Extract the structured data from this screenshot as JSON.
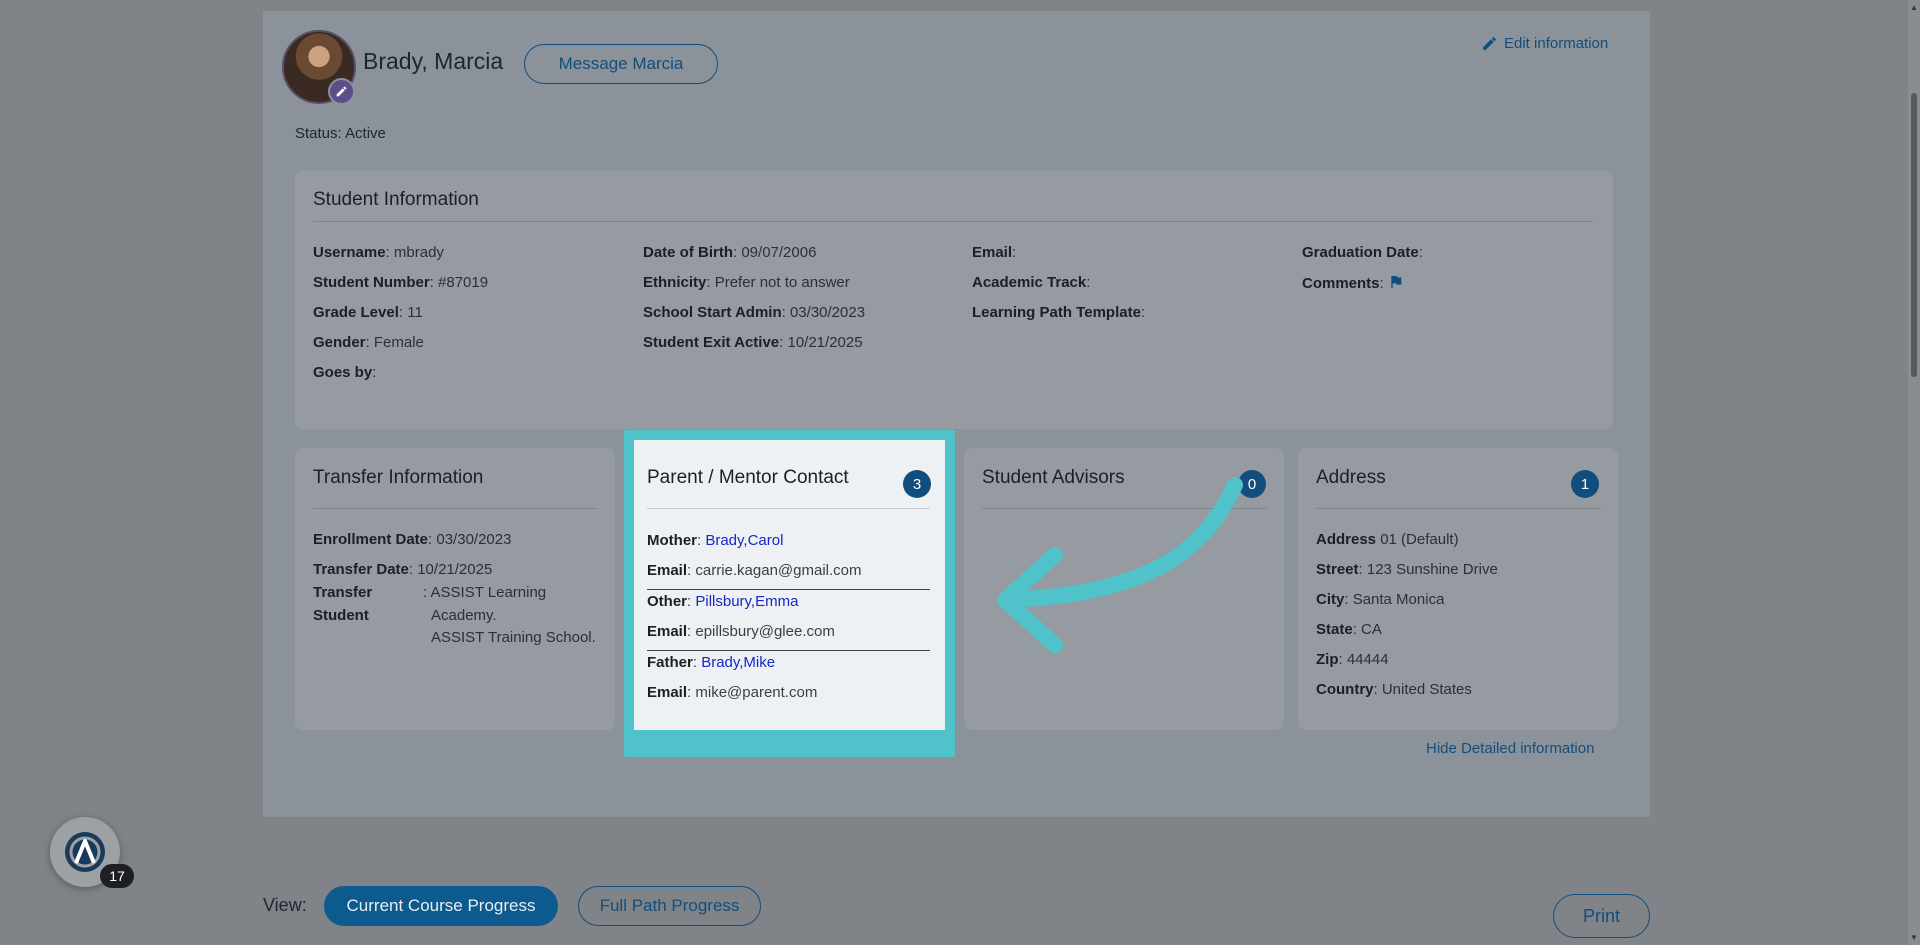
{
  "header": {
    "student_name": "Brady, Marcia",
    "message_button": "Message Marcia",
    "edit_information": "Edit information",
    "status_label": "Status:",
    "status_value": "Active"
  },
  "student_info": {
    "title": "Student Information",
    "col1": [
      {
        "label": "Username",
        "value": "mbrady"
      },
      {
        "label": "Student Number",
        "value": "#87019"
      },
      {
        "label": "Grade Level",
        "value": "11"
      },
      {
        "label": "Gender",
        "value": "Female"
      },
      {
        "label": "Goes by",
        "value": ""
      }
    ],
    "col2": [
      {
        "label": "Date of Birth",
        "value": "09/07/2006"
      },
      {
        "label": "Ethnicity",
        "value": "Prefer not to answer"
      },
      {
        "label": "School Start Admin",
        "value": "03/30/2023"
      },
      {
        "label": "Student Exit Active",
        "value": "10/21/2025"
      }
    ],
    "col3": [
      {
        "label": "Email",
        "value": ""
      },
      {
        "label": "Academic Track",
        "value": ""
      },
      {
        "label": "Learning Path Template",
        "value": ""
      }
    ],
    "col4": [
      {
        "label": "Graduation Date",
        "value": ""
      },
      {
        "label": "Comments",
        "value": ""
      }
    ]
  },
  "transfer": {
    "title": "Transfer Information",
    "enrollment_label": "Enrollment Date",
    "enrollment_value": "03/30/2023",
    "transfer_date_label": "Transfer Date",
    "transfer_date_value": "10/21/2025",
    "transfer_student_label_1": "Transfer",
    "transfer_student_label_2": "Student",
    "schools_1": ": ASSIST Learning",
    "schools_2": "Academy.",
    "schools_3": "ASSIST Training School."
  },
  "parent_contact": {
    "title": "Parent / Mentor Contact",
    "count": "3",
    "contacts": [
      {
        "relation": "Mother",
        "name": "Brady,Carol",
        "email": "carrie.kagan@gmail.com"
      },
      {
        "relation": "Other",
        "name": "Pillsbury,Emma",
        "email": "epillsbury@glee.com"
      },
      {
        "relation": "Father",
        "name": "Brady,Mike",
        "email": "mike@parent.com"
      }
    ],
    "email_label": "Email"
  },
  "advisors": {
    "title": "Student Advisors",
    "count": "0"
  },
  "address": {
    "title": "Address",
    "count": "1",
    "address_label": "Address",
    "address_value": "01 (Default)",
    "street_label": "Street",
    "street_value": "123 Sunshine Drive",
    "city_label": "City",
    "city_value": "Santa Monica",
    "state_label": "State",
    "state_value": "CA",
    "zip_label": "Zip",
    "zip_value": "44444",
    "country_label": "Country",
    "country_value": "United States"
  },
  "hide_detailed": "Hide Detailed information",
  "fab": {
    "count": "17"
  },
  "view_bar": {
    "label": "View:",
    "current_course": "Current Course Progress",
    "full_path": "Full Path Progress",
    "print": "Print"
  },
  "colors": {
    "primary": "#124e7d",
    "highlight": "#4fc3c9",
    "link": "#1725c9"
  }
}
